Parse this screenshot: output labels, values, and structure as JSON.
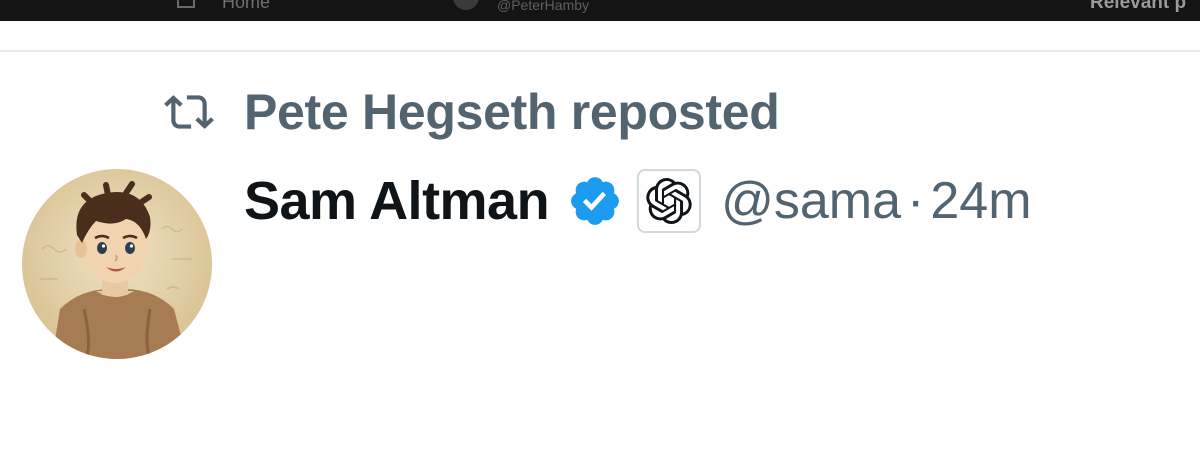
{
  "topbar": {
    "home_label": "Home",
    "handle": "@PeterHamby",
    "relevant": "Relevant p",
    "background": "#141414"
  },
  "repost": {
    "icon": "repost-icon",
    "text": "Pete Hegseth reposted",
    "color": "#536471"
  },
  "tweet": {
    "author_name": "Sam Altman",
    "verified_icon": "verified-badge-icon",
    "verified_color": "#1d9bf0",
    "affiliate_icon": "openai-logo-icon",
    "handle": "@sama",
    "separator": "·",
    "time": "24m",
    "avatar": "cartoon-avatar"
  },
  "colors": {
    "primary_text": "#0f1419",
    "secondary_text": "#536471",
    "divider": "#e6e9eb"
  }
}
